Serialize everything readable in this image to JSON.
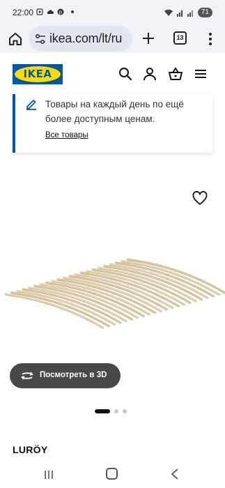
{
  "status_bar": {
    "time": "22:00",
    "battery": "71"
  },
  "browser": {
    "url": "ikea.com/lt/ru",
    "tab_count": "13"
  },
  "header": {
    "logo_text": "IKEA",
    "icons": [
      "search-icon",
      "user-icon",
      "basket-icon",
      "menu-icon"
    ]
  },
  "promo": {
    "text": "Товары на каждый день по ещё более доступным ценам.",
    "link": "Все товары"
  },
  "product": {
    "view_3d_label": "Посмотреть в 3D",
    "carousel_total": 3,
    "carousel_active": 1,
    "name": "LURÖY"
  },
  "colors": {
    "ikea_blue": "#0058a3",
    "ikea_yellow": "#ffdb00",
    "browser_bg": "#f1f3f8",
    "button_dark": "#484848"
  }
}
